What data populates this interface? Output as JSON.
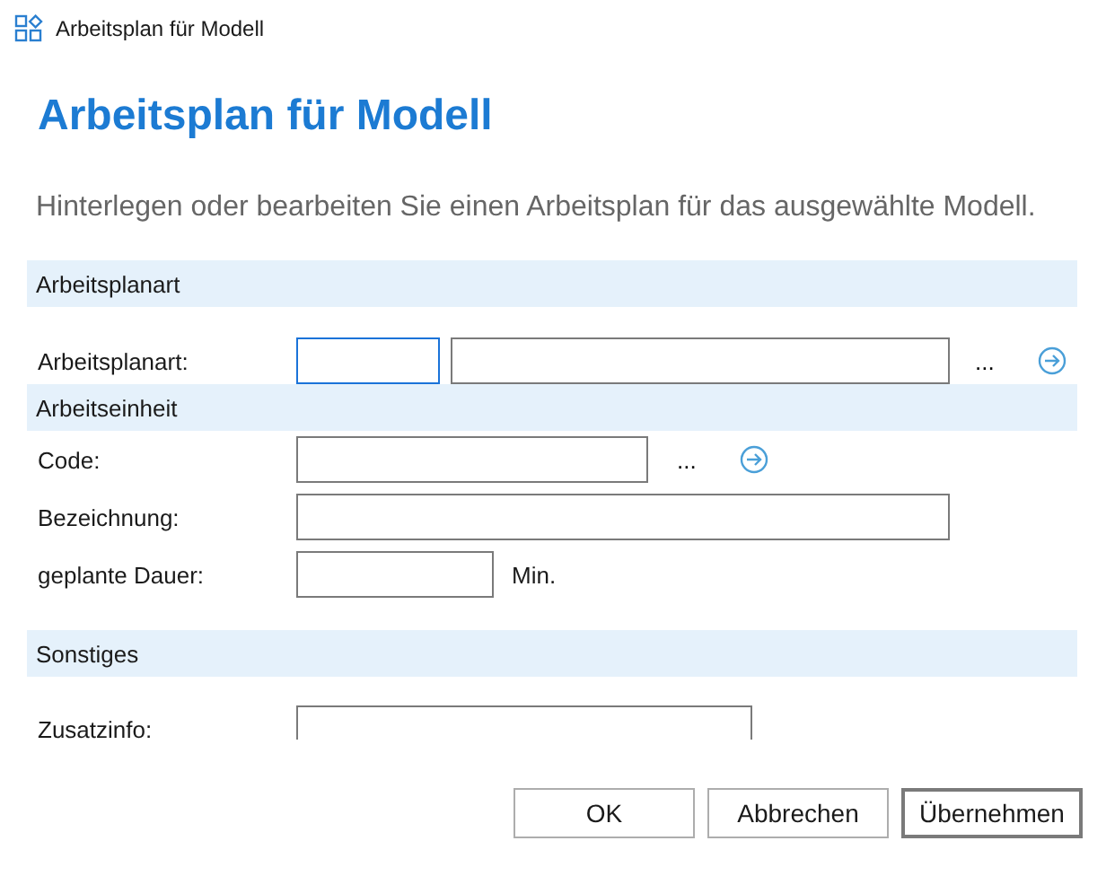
{
  "window": {
    "title": "Arbeitsplan für Modell"
  },
  "heading": "Arbeitsplan für Modell",
  "description": "Hinterlegen oder bearbeiten Sie einen Arbeitsplan für das ausgewählte Modell.",
  "sections": [
    {
      "title": "Arbeitsplanart",
      "rows": [
        {
          "label": "Arbeitsplanart:",
          "fields": [
            {
              "focused": true
            },
            {
              "focused": false
            }
          ],
          "browse": "...",
          "go": true
        }
      ]
    },
    {
      "title": "Arbeitseinheit",
      "rows": [
        {
          "label": "Code:",
          "fields": [
            {
              "focused": false
            }
          ],
          "browse": "...",
          "go": true
        },
        {
          "label": "Bezeichnung:",
          "fields": [
            {
              "focused": false
            }
          ]
        },
        {
          "label": "geplante Dauer:",
          "fields": [
            {
              "focused": false
            }
          ],
          "unit": "Min."
        }
      ]
    },
    {
      "title": "Sonstiges",
      "rows": [
        {
          "label": "Zusatzinfo:",
          "fields": [
            {
              "focused": false
            }
          ]
        }
      ]
    }
  ],
  "buttons": [
    {
      "label": "OK",
      "default": false
    },
    {
      "label": "Abbrechen",
      "default": false
    },
    {
      "label": "Übernehmen",
      "default": true
    }
  ]
}
